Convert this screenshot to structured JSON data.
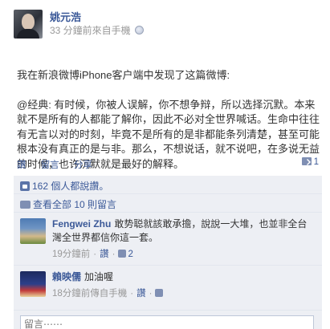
{
  "post": {
    "author": "姚元浩",
    "meta": "33 分鐘前來自手機",
    "body_lines": [
      "我在新浪微博iPhone客户端中发现了这篇微博:",
      "@经典: 有时候，你被人误解，你不想争辩，所以选择沉默。本来就不是所有的人都能了解你，因此不必对全世界喊话。生命中往往有无言以对的时刻，毕竟不是所有的是非都能条列清楚，甚至可能根本没有真正的是与非。那么，不想说话，就不说吧，在多说无益的时候，也许沉默就是最好的解释。"
    ]
  },
  "actions": {
    "like": "讚",
    "comment": "留言",
    "share": "分享",
    "share_count": "1"
  },
  "feedback": {
    "likes_text": "162 個人都說讚。",
    "view_all": "查看全部 10 則留言"
  },
  "comments": [
    {
      "author": "Fengwei Zhu",
      "text": "敢势聪就該敢承擔，說說一大堆，也並非全台灣全世界都信你這一套。",
      "time": "19分鐘前",
      "like": "讚",
      "likes": "2",
      "via": ""
    },
    {
      "author": "賴映儒",
      "text": "加油喔",
      "time": "18分鐘前傳自手機",
      "like": "讚",
      "likes": "",
      "via": ""
    }
  ],
  "compose": {
    "placeholder": "留言⋯⋯"
  },
  "icons": {
    "globe": "globe-icon",
    "like": "thumbs-up-icon",
    "share": "share-icon",
    "comments": "comment-bubble-icon"
  },
  "colors": {
    "link": "#3b5998",
    "feedback_bg": "#edeff4",
    "meta": "#999999"
  }
}
